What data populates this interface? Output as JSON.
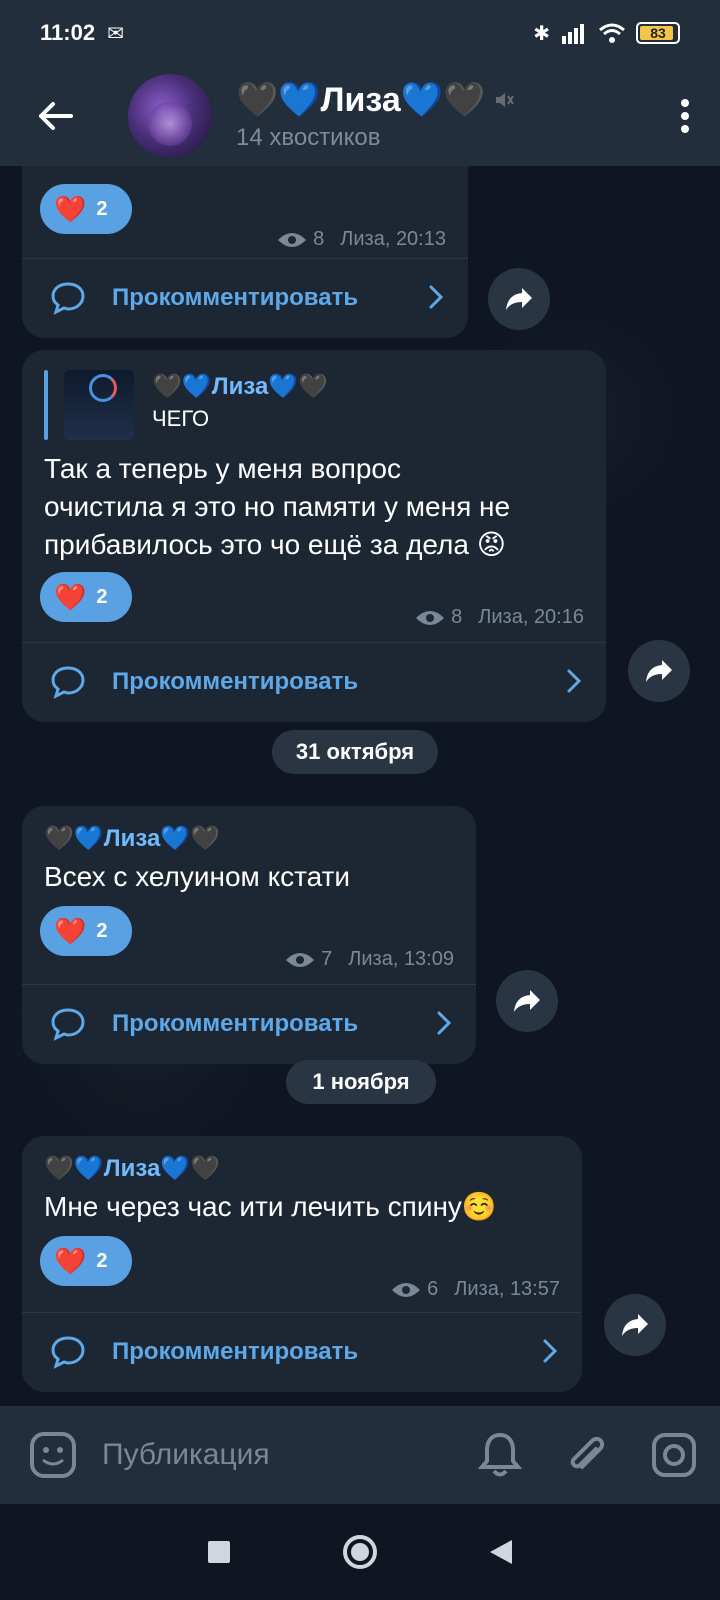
{
  "status_bar": {
    "time": "11:02",
    "battery": "83"
  },
  "header": {
    "title": "🖤💙Лиза💙🖤",
    "subtitle": "14 хвостиков"
  },
  "messages": [
    {
      "reaction_emoji": "❤️",
      "reaction_count": "2",
      "views": "8",
      "meta": "Лиза, 20:13",
      "comment_label": "Прокомментировать"
    },
    {
      "reply": {
        "author": "🖤💙Лиза💙🖤",
        "text": "ЧЕГО"
      },
      "text_lines": [
        "Так а теперь у меня вопрос",
        "очистила я это но памяти у меня не",
        "прибавилось это чо ещё за дела 😡"
      ],
      "reaction_emoji": "❤️",
      "reaction_count": "2",
      "views": "8",
      "meta": "Лиза, 20:16",
      "comment_label": "Прокомментировать"
    },
    {
      "date": "31 октября",
      "author": "🖤💙Лиза💙🖤",
      "text": "Всех с хелуином кстати",
      "reaction_emoji": "❤️",
      "reaction_count": "2",
      "views": "7",
      "meta": "Лиза, 13:09",
      "comment_label": "Прокомментировать"
    },
    {
      "date": "1 ноября",
      "author": "🖤💙Лиза💙🖤",
      "text": "Мне через час ити лечить спину☺️",
      "reaction_emoji": "❤️",
      "reaction_count": "2",
      "views": "6",
      "meta": "Лиза, 13:57",
      "comment_label": "Прокомментировать"
    }
  ],
  "input": {
    "placeholder": "Публикация"
  },
  "colors": {
    "accent": "#5aa1e4",
    "bubble": "#1d2733",
    "bar": "#232e3c"
  },
  "icons": [
    "back-arrow-icon",
    "mute-icon",
    "more-vertical-icon",
    "eye-icon",
    "comment-icon",
    "chevron-right-icon",
    "share-icon",
    "sticker-icon",
    "bell-icon",
    "paperclip-icon",
    "camera-icon",
    "nav-square-icon",
    "nav-circle-icon",
    "nav-back-icon"
  ]
}
